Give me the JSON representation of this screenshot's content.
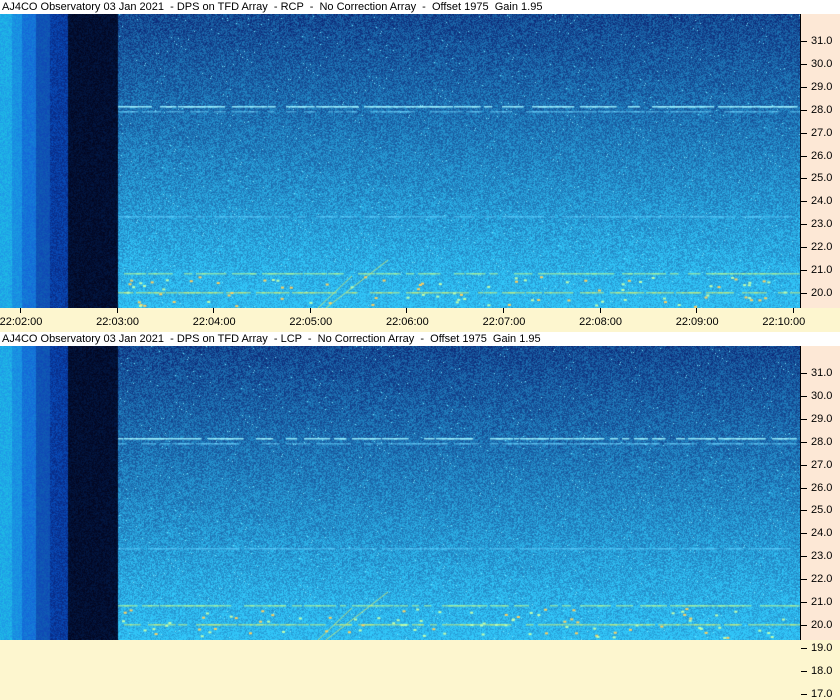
{
  "panels": [
    {
      "title": "AJ4CO Observatory 03 Jan 2021  - DPS on TFD Array  - RCP  -  No Correction Array  -  Offset 1975  Gain 1.95"
    },
    {
      "title": "AJ4CO Observatory 03 Jan 2021  - DPS on TFD Array  - LCP  -  No Correction Array  -  Offset 1975  Gain 1.95"
    }
  ],
  "y_axis": {
    "labels": [
      "31.0",
      "30.0",
      "29.0",
      "28.0",
      "27.0",
      "26.0",
      "25.0",
      "24.0",
      "23.0",
      "22.0",
      "21.0",
      "20.0",
      "19.0",
      "18.0",
      "17.0"
    ]
  },
  "x_axis": {
    "labels": [
      "22:02:00",
      "22:03:00",
      "22:04:00",
      "22:05:00",
      "22:06:00",
      "22:07:00",
      "22:08:00",
      "22:09:00",
      "22:10:00"
    ]
  },
  "colors": {
    "background": "#fdf6cf",
    "y_axis_bg": "#fde8d6",
    "spectro_top": "#0a1a70",
    "spectro_bottom": "#1f7df0"
  }
}
